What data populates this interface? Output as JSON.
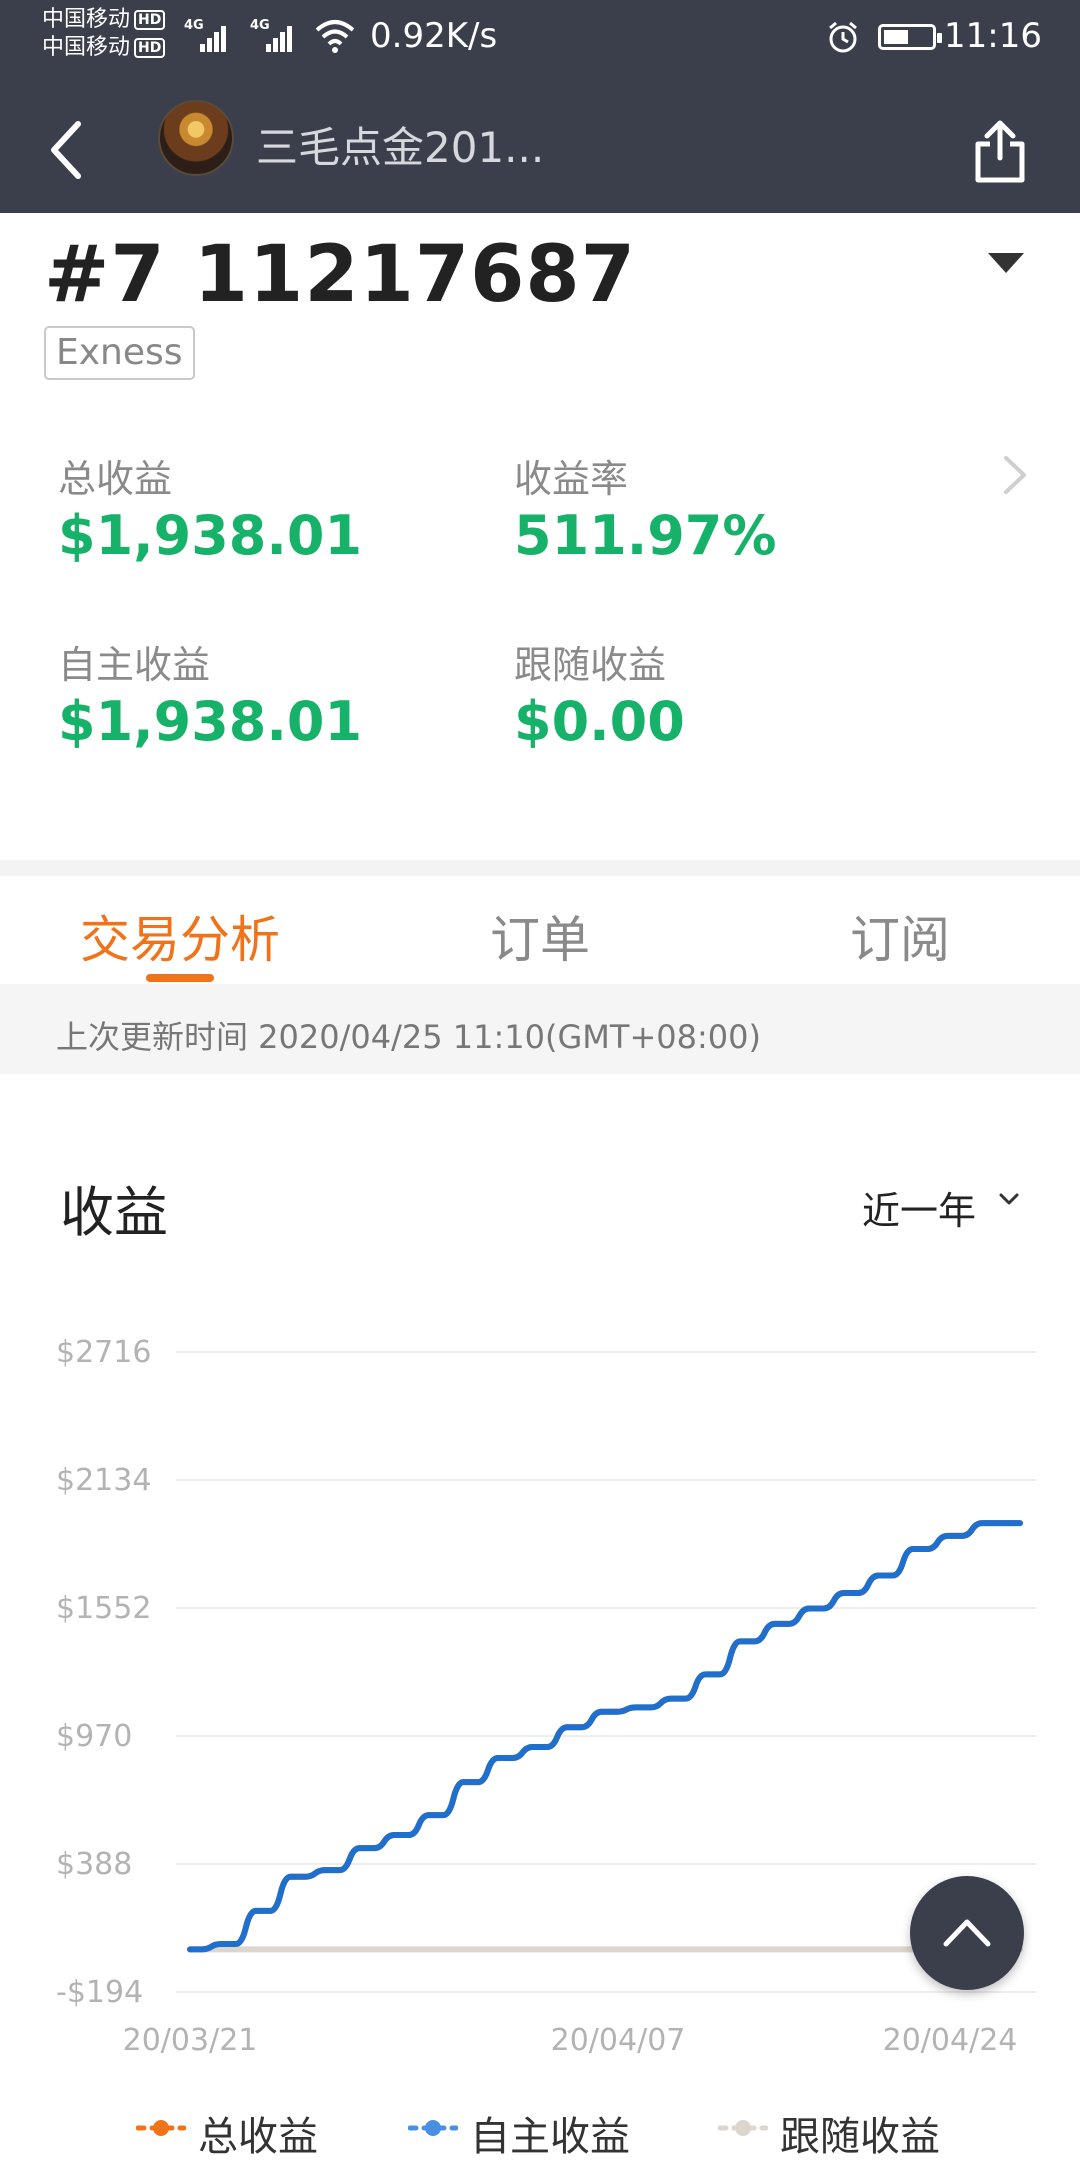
{
  "status_bar": {
    "carrier1": "中国移动",
    "carrier2": "中国移动",
    "hd_badge": "HD",
    "net_label": "4G",
    "speed": "0.92K/s",
    "time": "11:16"
  },
  "header": {
    "title": "三毛点金201..."
  },
  "account": {
    "id": "#7 11217687",
    "broker": "Exness"
  },
  "stats": {
    "total_profit_label": "总收益",
    "total_profit": "$1,938.01",
    "rate_label": "收益率",
    "rate": "511.97%",
    "self_profit_label": "自主收益",
    "self_profit": "$1,938.01",
    "follow_profit_label": "跟随收益",
    "follow_profit": "$0.00"
  },
  "tabs": [
    {
      "label": "交易分析",
      "active": true
    },
    {
      "label": "订单",
      "active": false
    },
    {
      "label": "订阅",
      "active": false
    }
  ],
  "update_text": "上次更新时间 2020/04/25 11:10(GMT+08:00)",
  "section": {
    "title": "收益",
    "range": "近一年"
  },
  "colors": {
    "green": "#17b26a",
    "orange": "#f07319",
    "blue": "#1f6fcf",
    "gray_line": "#ddd6cc"
  },
  "chart_data": {
    "type": "line",
    "y_ticks": [
      "$2716",
      "$2134",
      "$1552",
      "$970",
      "$388",
      "-$194"
    ],
    "y_tick_values": [
      2716,
      2134,
      1552,
      970,
      388,
      -194
    ],
    "x_ticks": [
      "20/03/21",
      "20/04/07",
      "20/04/24"
    ],
    "ylim": [
      -194,
      2716
    ],
    "series": [
      {
        "name": "总收益",
        "color": "#f07319",
        "values": [
          0,
          24,
          175,
          330,
          360,
          460,
          520,
          610,
          760,
          870,
          920,
          1010,
          1080,
          1100,
          1140,
          1250,
          1400,
          1480,
          1550,
          1620,
          1700,
          1820,
          1880,
          1938,
          1938
        ]
      },
      {
        "name": "自主收益",
        "color": "#1f6fcf",
        "values": [
          0,
          24,
          175,
          330,
          360,
          460,
          520,
          610,
          760,
          870,
          920,
          1010,
          1080,
          1100,
          1140,
          1250,
          1400,
          1480,
          1550,
          1620,
          1700,
          1820,
          1880,
          1938,
          1938
        ]
      },
      {
        "name": "跟随收益",
        "color": "#ddd6cc",
        "values": [
          0,
          0,
          0,
          0,
          0,
          0,
          0,
          0,
          0,
          0,
          0,
          0,
          0,
          0,
          0,
          0,
          0,
          0,
          0,
          0,
          0,
          0,
          0,
          0,
          0
        ]
      }
    ],
    "legend": [
      "总收益",
      "自主收益",
      "跟随收益"
    ],
    "grid": true,
    "legend_position": "bottom"
  }
}
